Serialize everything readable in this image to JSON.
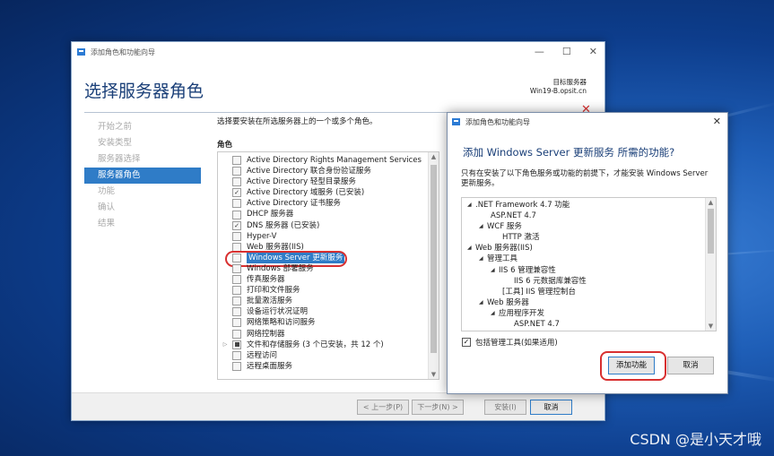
{
  "wizard": {
    "title": "添加角色和功能向导",
    "heading": "选择服务器角色",
    "target_label": "目标服务器",
    "target_server": "Win19-B.opsit.cn",
    "controls": {
      "minimize": "—",
      "maximize": "☐",
      "close": "✕"
    },
    "close_mark": "✕",
    "nav": [
      "开始之前",
      "安装类型",
      "服务器选择",
      "服务器角色",
      "功能",
      "确认",
      "结果"
    ],
    "nav_active_index": 3,
    "instruction": "选择要安装在所选服务器上的一个或多个角色。",
    "roles_header": "角色",
    "roles": [
      {
        "label": "Active Directory Rights Management Services",
        "checked": false
      },
      {
        "label": "Active Directory 联合身份验证服务",
        "checked": false
      },
      {
        "label": "Active Directory 轻型目录服务",
        "checked": false
      },
      {
        "label": "Active Directory 域服务 (已安装)",
        "checked": true
      },
      {
        "label": "Active Directory 证书服务",
        "checked": false
      },
      {
        "label": "DHCP 服务器",
        "checked": false
      },
      {
        "label": "DNS 服务器 (已安装)",
        "checked": true
      },
      {
        "label": "Hyper-V",
        "checked": false
      },
      {
        "label": "Web 服务器(IIS)",
        "checked": false
      },
      {
        "label": "Windows Server 更新服务",
        "checked": false,
        "selected": true
      },
      {
        "label": "Windows 部署服务",
        "checked": false
      },
      {
        "label": "传真服务器",
        "checked": false
      },
      {
        "label": "打印和文件服务",
        "checked": false
      },
      {
        "label": "批量激活服务",
        "checked": false
      },
      {
        "label": "设备运行状况证明",
        "checked": false
      },
      {
        "label": "网络策略和访问服务",
        "checked": false
      },
      {
        "label": "网络控制器",
        "checked": false
      },
      {
        "label": "文件和存储服务 (3 个已安装，共 12 个)",
        "checked": "partial",
        "expandable": true
      },
      {
        "label": "远程访问",
        "checked": false
      },
      {
        "label": "远程桌面服务",
        "checked": false
      }
    ],
    "buttons": {
      "prev": "< 上一步(P)",
      "next": "下一步(N) >",
      "install": "安装(I)",
      "cancel": "取消"
    }
  },
  "dialog": {
    "title": "添加角色和功能向导",
    "close": "✕",
    "heading": "添加 Windows Server 更新服务 所需的功能?",
    "description": "只有在安装了以下角色服务或功能的前提下，才能安装 Windows Server 更新服务。",
    "tree": [
      {
        "label": ".NET Framework 4.7 功能",
        "level": 0,
        "arrow": true
      },
      {
        "label": "ASP.NET 4.7",
        "level": 1,
        "arrow": false
      },
      {
        "label": "WCF 服务",
        "level": 1,
        "arrow": true
      },
      {
        "label": "HTTP 激活",
        "level": 2,
        "arrow": false
      },
      {
        "label": "Web 服务器(IIS)",
        "level": 0,
        "arrow": true
      },
      {
        "label": "管理工具",
        "level": 1,
        "arrow": true
      },
      {
        "label": "IIS 6 管理兼容性",
        "level": 2,
        "arrow": true
      },
      {
        "label": "IIS 6 元数据库兼容性",
        "level": 3,
        "arrow": false
      },
      {
        "label": "[工具] IIS 管理控制台",
        "level": 2,
        "arrow": false
      },
      {
        "label": "Web 服务器",
        "level": 1,
        "arrow": true
      },
      {
        "label": "应用程序开发",
        "level": 2,
        "arrow": true
      },
      {
        "label": "ASP.NET 4.7",
        "level": 3,
        "arrow": false
      }
    ],
    "include_tools_label": "包括管理工具(如果适用)",
    "include_tools_checked": true,
    "buttons": {
      "add": "添加功能",
      "cancel": "取消"
    }
  },
  "watermark": "CSDN @是小天才哦"
}
